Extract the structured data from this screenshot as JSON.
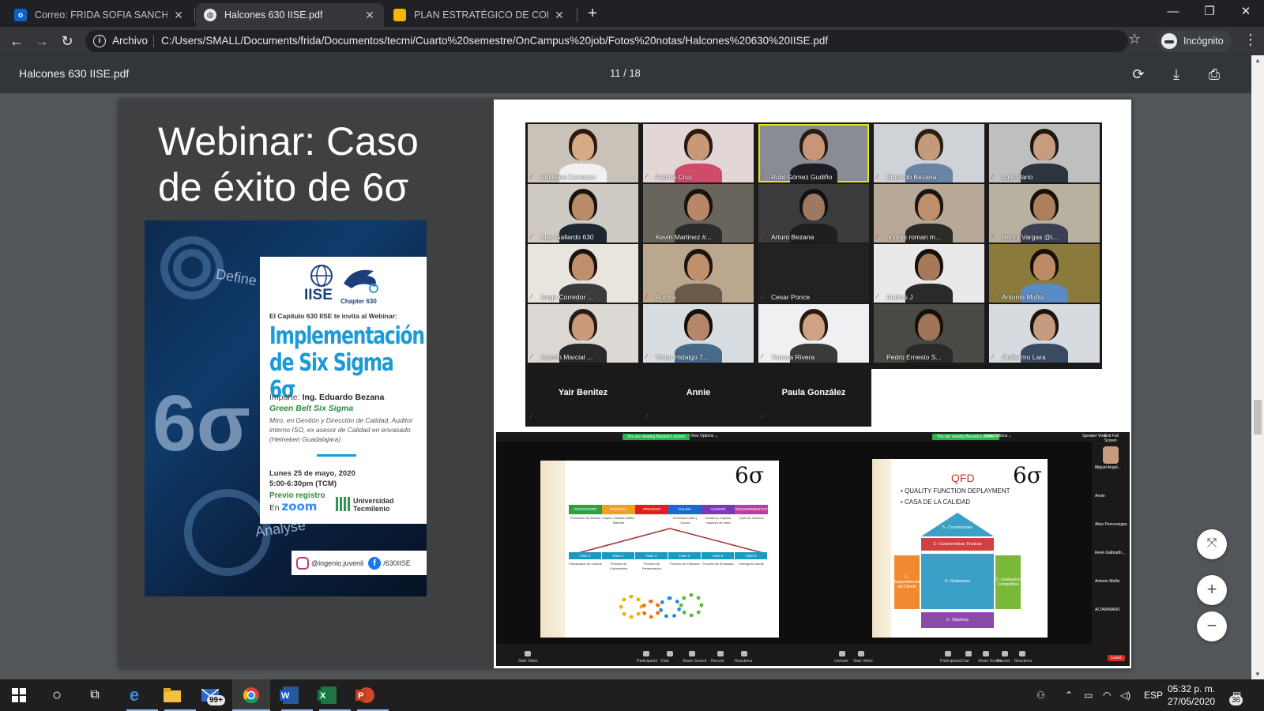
{
  "tabs": [
    {
      "label": "Correo: FRIDA SOFIA SANCHEZ M",
      "icon": "outlook-icon"
    },
    {
      "label": "Halcones 630 IISE.pdf",
      "icon": "globe-icon"
    },
    {
      "label": "PLAN ESTRATÉGICO DE COMUNI",
      "icon": "slides-icon"
    }
  ],
  "window": {
    "minimize": "—",
    "maximize": "❐",
    "close": "✕"
  },
  "toolbar": {
    "security_label": "Archivo",
    "url": "C:/Users/SMALL/Documents/frida/Documentos/tecmi/Cuarto%20semestre/OnCampus%20job/Fotos%20notas/Halcones%20630%20IISE.pdf",
    "incognito_label": "Incógnito"
  },
  "pdf": {
    "title": "Halcones 630 IISE.pdf",
    "page_indicator": "11 / 18"
  },
  "slide": {
    "title_line1": "Webinar: Caso",
    "title_line2": "de éxito de 6σ"
  },
  "poster": {
    "word_define": "Define",
    "word_analyse": "Analyse",
    "big_sigma": "6σ",
    "iise": "IISE",
    "chapter": "Chapter 630",
    "invite": "El Capítulo 630 IISE te invita al Webinar:",
    "headline": "Implementación de Six Sigma 6σ",
    "imparte_prefix": "Imparte:",
    "speaker": "Ing. Eduardo Bezana",
    "belt": "Green Belt Six Sigma",
    "desc": "Mtro. en Gestión y Dirección de Calidad, Auditor interno ISO, ex asesor de Calidad en envasado (Heineken Guadalajara)",
    "date": "Lunes 25 de mayo, 2020",
    "time": "5:00-6:30pm (TCM)",
    "registro": "Previo registro",
    "en": "En",
    "zoom": "zoom",
    "universidad": "Universidad",
    "tecmilenio": "Tecmilenio",
    "instagram": "@ingenio.juvenil",
    "facebook": "/630IISE"
  },
  "participants": [
    {
      "name": "Viridiana Carrasco",
      "bg": "#c9c2b8",
      "skin": "#d8a985",
      "hair": "#2a1a12",
      "shirt": "#f1f1f1"
    },
    {
      "name": "Fatima Cruz",
      "bg": "#e3d6d6",
      "skin": "#c99877",
      "hair": "#2b1810",
      "shirt": "#d14a6a"
    },
    {
      "name": "Rubí Gómez Gudiño",
      "bg": "#8a8c95",
      "skin": "#c69677",
      "hair": "#2a1a12",
      "shirt": "#1d1d23"
    },
    {
      "name": "Eduardo Bezana",
      "bg": "#cfd3d8",
      "skin": "#c49a7a",
      "hair": "#2a2016",
      "shirt": "#6a84a6"
    },
    {
      "name": "Luis Mario",
      "bg": "#bfbfbf",
      "skin": "#c89c7e",
      "hair": "#1e1610",
      "shirt": "#2c3440"
    },
    {
      "name": "Alex Gallardo 630",
      "bg": "#cfcbc4",
      "skin": "#b98b68",
      "hair": "#1a120c",
      "shirt": "#1f2733"
    },
    {
      "name": "Kevin Martinez #...",
      "bg": "#6a655c",
      "skin": "#b8876a",
      "hair": "#1a120c",
      "shirt": "#2c2c2c"
    },
    {
      "name": "Arturo Bezana",
      "bg": "#3b3b3b",
      "skin": "#9c7a62",
      "hair": "#111",
      "shirt": "#1f1f1f"
    },
    {
      "name": "andres roman m...",
      "bg": "#b8a898",
      "skin": "#c08f6e",
      "hair": "#1c140e",
      "shirt": "#2d2b28"
    },
    {
      "name": "Henry Vargas @i...",
      "bg": "#b8b1a0",
      "skin": "#ad7f5d",
      "hair": "#181008",
      "shirt": "#3a3f52"
    },
    {
      "name": "Jorge Corredor ...",
      "bg": "#e8e4de",
      "skin": "#c18f6c",
      "hair": "#1c140e",
      "shirt": "#3b3b3b"
    },
    {
      "name": "Aurora",
      "bg": "#b9a88e",
      "skin": "#c18f6c",
      "hair": "#1c140e",
      "shirt": "#6b5a4a"
    },
    {
      "name": "Cesar Ponce",
      "bg": "#222222",
      "skin": "",
      "hair": "",
      "shirt": ""
    },
    {
      "name": "Andres J",
      "bg": "#e9e9e9",
      "skin": "#a8785a",
      "hair": "#16100a",
      "shirt": "#2a2a2a"
    },
    {
      "name": "Antonio Muñiz",
      "bg": "#8a7a3c",
      "skin": "#bc8a66",
      "hair": "#16100a",
      "shirt": "#5a8ac4"
    },
    {
      "name": "Jazmin Marcial ...",
      "bg": "#dcd8d4",
      "skin": "#c89a78",
      "hair": "#2a1a12",
      "shirt": "#2a2a2a"
    },
    {
      "name": "Victor Hidalgo 7...",
      "bg": "#d8dde2",
      "skin": "#b5876a",
      "hair": "#16100a",
      "shirt": "#4a6a8a"
    },
    {
      "name": "Yanesa Rivera",
      "bg": "#eef0f1",
      "skin": "#d0a183",
      "hair": "#2a1a12",
      "shirt": "#3a3a3a"
    },
    {
      "name": "Pedro Ernesto S...",
      "bg": "#4a4a44",
      "skin": "#a07458",
      "hair": "#16100a",
      "shirt": "#2a2a2a"
    },
    {
      "name": "Guillermo Lara",
      "bg": "#d7dbe0",
      "skin": "#c69b7e",
      "hair": "#1c140e",
      "shirt": "#3a4a62"
    }
  ],
  "name_tiles": [
    "Yair Benitez",
    "Annie",
    "Paula González"
  ],
  "share_left": {
    "tag": "You are viewing Bezana's screen",
    "view_options": "View Options ⌄",
    "sigma": "6σ",
    "headers": [
      "PROVEEDOR",
      "ENTRADA",
      "PROCESO",
      "SALIDA",
      "CLIENTE",
      "REQUERIMIENTOS"
    ],
    "header_colors": [
      "#2ea043",
      "#f0a020",
      "#e02020",
      "#1a6ad0",
      "#7a3ab8",
      "#c03aa0"
    ],
    "cells": [
      "Proveedor de Granos",
      "Lúpulo, Cebada, Malta, Marmite",
      "",
      "Cervezas Clara y Oscura",
      "Hombre y mujeres mayores de edad",
      "Tipos de Cerveza"
    ],
    "phases": [
      "Fase 1",
      "Fase 2",
      "Fase 3",
      "Fase 4",
      "Fase 5",
      "Fase 6"
    ],
    "phase_desc": [
      "Preparación de Granos",
      "Proceso de Cocimientos",
      "Proceso de Fermentación",
      "Proceso de Filtración",
      "Proceso de Envasado",
      "Entrega al Cliente"
    ],
    "bottom": [
      "Start Video",
      "Participants",
      "Chat",
      "Share Screen",
      "Record",
      "Reactions"
    ]
  },
  "share_right": {
    "tag": "You are viewing Bezana's screen",
    "view_options": "View Options ⌄",
    "qfd": "QFD",
    "sigma": "6σ",
    "bullet1": "QUALITY FUNCTION DEPLAYMENT",
    "bullet2": "CASA DE LA CALIDAD",
    "blocks": [
      "5.- Correlaciones",
      "3.- Características Técnicas",
      "1.- Requerimientos del Cliente",
      "4.- Relaciones",
      "2.- Evaluación Competitiva",
      "6.- Objetivos"
    ],
    "side_names": [
      "Miguel Angel...",
      "Annie",
      "Aline Perezvargas",
      "René Galbraith...",
      "Antonio Muñiz",
      "ALTAMIRANO"
    ],
    "bottom": [
      "Unmute",
      "Start Video",
      "Participants",
      "Chat",
      "Share Screen",
      "Record",
      "Reactions"
    ],
    "end": "Leave",
    "speaker_view": "Speaker View",
    "exit_full": "Exit Full Screen"
  },
  "taskbar": {
    "mail_badge": "99+",
    "lang": "ESP",
    "time": "05:32 p. m.",
    "date": "27/05/2020",
    "notifications": "36"
  }
}
